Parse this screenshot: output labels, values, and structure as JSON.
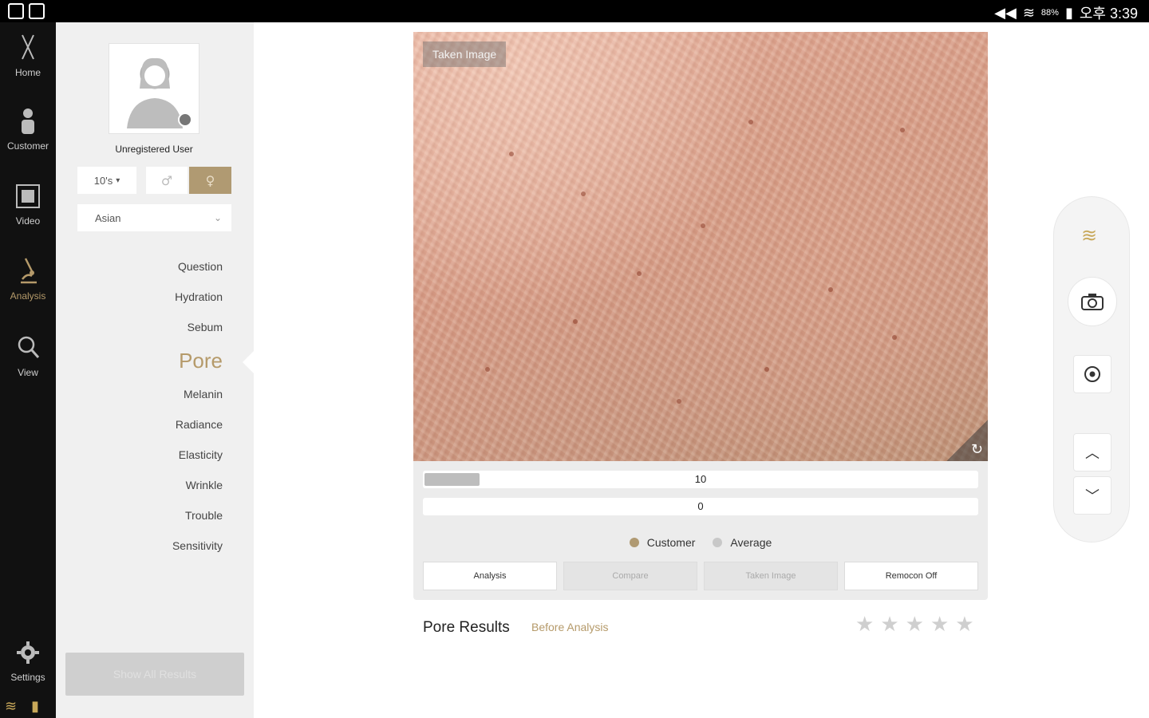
{
  "status_bar": {
    "battery": "88%",
    "time": "오후 3:39"
  },
  "nav": {
    "items": [
      {
        "label": "Home",
        "icon": "scissors-icon"
      },
      {
        "label": "Customer",
        "icon": "person-icon"
      },
      {
        "label": "Video",
        "icon": "film-icon"
      },
      {
        "label": "Analysis",
        "icon": "microscope-icon",
        "active": true
      },
      {
        "label": "View",
        "icon": "search-icon"
      },
      {
        "label": "Settings",
        "icon": "gear-icon"
      }
    ]
  },
  "profile": {
    "username": "Unregistered User",
    "age": "10's",
    "race": "Asian",
    "gender_selected": "female"
  },
  "menu": {
    "items": [
      "Question",
      "Hydration",
      "Sebum",
      "Pore",
      "Melanin",
      "Radiance",
      "Elasticity",
      "Wrinkle",
      "Trouble",
      "Sensitivity"
    ],
    "active": "Pore"
  },
  "show_all_button": "Show All Results",
  "image": {
    "label": "Taken Image"
  },
  "bars": {
    "customer": {
      "value": "10",
      "fraction": 0.1
    },
    "average": {
      "value": "0",
      "fraction": 0
    }
  },
  "legend": {
    "customer": "Customer",
    "average": "Average"
  },
  "tabs": [
    "Analysis",
    "Compare",
    "Taken Image",
    "Remocon Off"
  ],
  "results": {
    "title": "Pore Results",
    "status": "Before Analysis",
    "stars": 0,
    "max_stars": 5
  },
  "colors": {
    "accent": "#b59a6a",
    "customer": "#b09a72",
    "average": "#c8c8c8",
    "nav_bg": "#111111"
  }
}
